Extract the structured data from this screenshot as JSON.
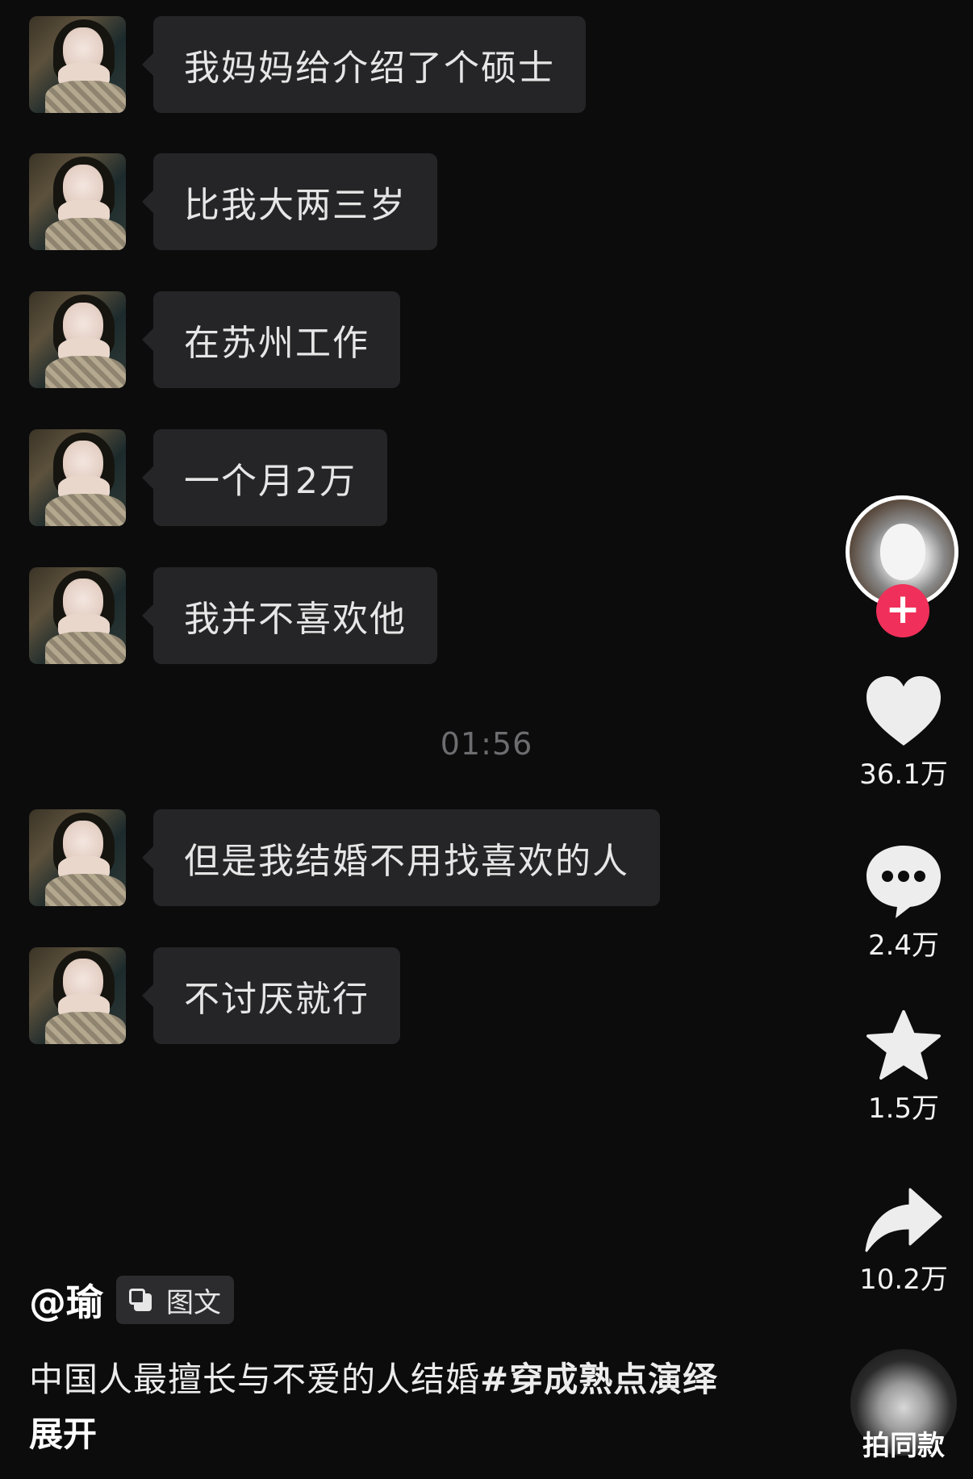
{
  "messages": [
    {
      "text": "我妈妈给介绍了个硕士"
    },
    {
      "text": "比我大两三岁"
    },
    {
      "text": "在苏州工作"
    },
    {
      "text": "一个月2万"
    },
    {
      "text": "我并不喜欢他"
    },
    {
      "text": "但是我结婚不用找喜欢的人"
    },
    {
      "text": "不讨厌就行"
    }
  ],
  "timestamp": "01:56",
  "actions": {
    "likes": "36.1万",
    "comments": "2.4万",
    "favorites": "1.5万",
    "shares": "10.2万",
    "follow_symbol": "+"
  },
  "caption": {
    "username": "@瑜",
    "tag": "图文",
    "text": "中国人最擅长与不爱的人结婚",
    "hashtag": "#穿成熟点演绎",
    "expand": "展开"
  },
  "music": {
    "label": "拍同款"
  },
  "colors": {
    "background": "#0c0c0d",
    "bubble": "#252527",
    "follow": "#f0305a"
  },
  "icons": [
    "heart-icon",
    "comment-icon",
    "star-icon",
    "share-icon",
    "image-text-icon",
    "plus-icon"
  ]
}
